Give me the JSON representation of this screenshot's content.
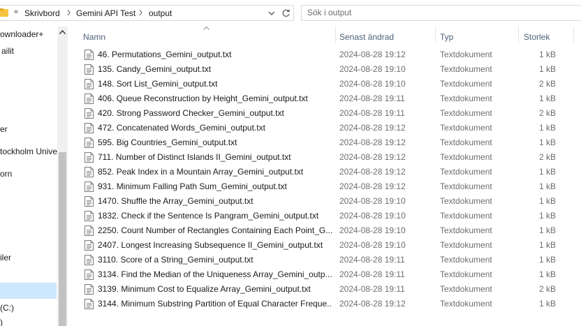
{
  "breadcrumb": {
    "overflow": "«",
    "items": [
      "Skrivbord",
      "Gemini API Test",
      "output"
    ]
  },
  "search": {
    "placeholder": "Sök i output"
  },
  "nav": {
    "items": [
      "ownloader+",
      "ailit",
      "er",
      "tockholm Unive",
      "orn",
      "iler",
      "(C:)",
      ")"
    ]
  },
  "columns": {
    "name": "Namn",
    "date": "Senast ändrad",
    "type": "Typ",
    "size": "Storlek"
  },
  "files": [
    {
      "name": "46. Permutations_Gemini_output.txt",
      "date": "2024-08-28 19:12",
      "type": "Textdokument",
      "size": "1 kB"
    },
    {
      "name": "135. Candy_Gemini_output.txt",
      "date": "2024-08-28 19:10",
      "type": "Textdokument",
      "size": "1 kB"
    },
    {
      "name": "148. Sort List_Gemini_output.txt",
      "date": "2024-08-28 19:10",
      "type": "Textdokument",
      "size": "2 kB"
    },
    {
      "name": "406. Queue Reconstruction by Height_Gemini_output.txt",
      "date": "2024-08-28 19:11",
      "type": "Textdokument",
      "size": "1 kB"
    },
    {
      "name": "420. Strong Password Checker_Gemini_output.txt",
      "date": "2024-08-28 19:11",
      "type": "Textdokument",
      "size": "2 kB"
    },
    {
      "name": "472. Concatenated Words_Gemini_output.txt",
      "date": "2024-08-28 19:12",
      "type": "Textdokument",
      "size": "1 kB"
    },
    {
      "name": "595. Big Countries_Gemini_output.txt",
      "date": "2024-08-28 19:12",
      "type": "Textdokument",
      "size": "1 kB"
    },
    {
      "name": "711. Number of Distinct Islands II_Gemini_output.txt",
      "date": "2024-08-28 19:12",
      "type": "Textdokument",
      "size": "2 kB"
    },
    {
      "name": "852. Peak Index in a Mountain Array_Gemini_output.txt",
      "date": "2024-08-28 19:12",
      "type": "Textdokument",
      "size": "1 kB"
    },
    {
      "name": "931. Minimum Falling Path Sum_Gemini_output.txt",
      "date": "2024-08-28 19:12",
      "type": "Textdokument",
      "size": "1 kB"
    },
    {
      "name": "1470. Shuffle the Array_Gemini_output.txt",
      "date": "2024-08-28 19:10",
      "type": "Textdokument",
      "size": "1 kB"
    },
    {
      "name": "1832. Check if the Sentence Is Pangram_Gemini_output.txt",
      "date": "2024-08-28 19:10",
      "type": "Textdokument",
      "size": "1 kB"
    },
    {
      "name": "2250. Count Number of Rectangles Containing Each Point_G...",
      "date": "2024-08-28 19:10",
      "type": "Textdokument",
      "size": "1 kB"
    },
    {
      "name": "2407. Longest Increasing Subsequence II_Gemini_output.txt",
      "date": "2024-08-28 19:10",
      "type": "Textdokument",
      "size": "1 kB"
    },
    {
      "name": "3110. Score of a String_Gemini_output.txt",
      "date": "2024-08-28 19:11",
      "type": "Textdokument",
      "size": "1 kB"
    },
    {
      "name": "3134. Find the Median of the Uniqueness Array_Gemini_outp...",
      "date": "2024-08-28 19:11",
      "type": "Textdokument",
      "size": "1 kB"
    },
    {
      "name": "3139. Minimum Cost to Equalize Array_Gemini_output.txt",
      "date": "2024-08-28 19:11",
      "type": "Textdokument",
      "size": "2 kB"
    },
    {
      "name": "3144. Minimum Substring Partition of Equal Character Freque...",
      "date": "2024-08-28 19:12",
      "type": "Textdokument",
      "size": "1 kB"
    }
  ],
  "colors": {
    "selection": "#cce8ff",
    "header_text": "#4c607a",
    "folder": "#f5c542"
  }
}
